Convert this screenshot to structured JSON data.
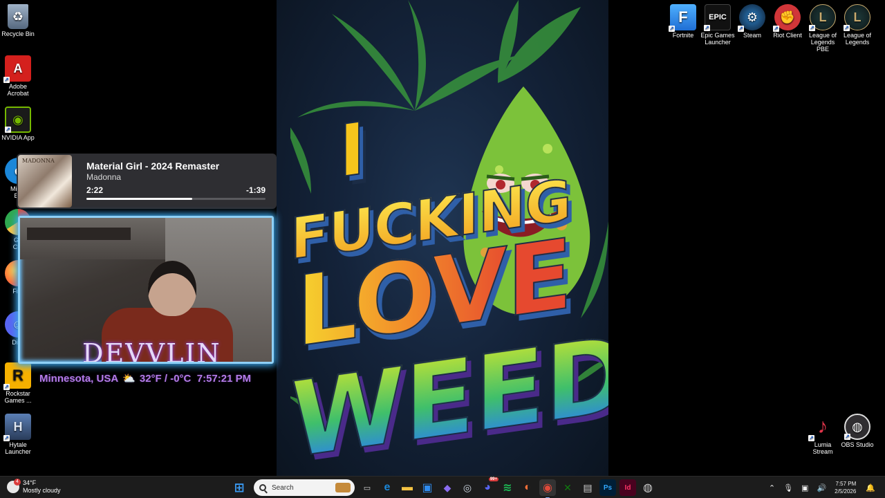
{
  "desktop": {
    "left_icons": [
      {
        "label": "Recycle Bin",
        "icon": "recycle-bin-icon",
        "color": "#6b7f95"
      },
      {
        "label": "Adobe Acrobat",
        "icon": "adobe-acrobat-icon",
        "color": "#d4201d"
      },
      {
        "label": "NVIDIA App",
        "icon": "nvidia-icon",
        "color": "#76b900"
      },
      {
        "label": "Microsoft Edge",
        "icon": "edge-icon",
        "color": "#1b87d9"
      },
      {
        "label": "Google Chrome",
        "icon": "chrome-icon",
        "color": "#e04a3a"
      },
      {
        "label": "Firefox",
        "icon": "firefox-icon",
        "color": "#ff7139"
      },
      {
        "label": "Discord",
        "icon": "discord-icon",
        "color": "#5865f2"
      },
      {
        "label": "Rockstar Games ...",
        "icon": "rockstar-icon",
        "color": "#f6b100"
      },
      {
        "label": "Hytale Launcher",
        "icon": "hytale-icon",
        "color": "#2a3c5a"
      }
    ],
    "left_icons_visible": [
      "Recycle Bin",
      "Adobe\nAcrobat",
      "NVIDIA App",
      "Micro\nEd",
      "Go\nChr",
      "Fire",
      "Disc",
      "Rockstar\nGames ...",
      "Hytale\nLauncher"
    ],
    "right_icons": [
      {
        "label": "Fortnite",
        "icon": "fortnite-icon",
        "color": "#2f80ed"
      },
      {
        "label": "Epic Games Launcher",
        "icon": "epic-games-icon",
        "color": "#111111"
      },
      {
        "label": "Steam",
        "icon": "steam-icon",
        "color": "#1b2838"
      },
      {
        "label": "Riot Client",
        "icon": "riot-client-icon",
        "color": "#d13639"
      },
      {
        "label": "League of Legends PBE",
        "icon": "league-pbe-icon",
        "color": "#c8aa6e"
      },
      {
        "label": "League of Legends",
        "icon": "league-icon",
        "color": "#c8aa6e"
      }
    ],
    "bottom_right_icons": [
      {
        "label": "Lumia Stream",
        "icon": "lumia-stream-icon",
        "color": "#e0344a"
      },
      {
        "label": "OBS Studio",
        "icon": "obs-icon",
        "color": "#302e31"
      }
    ]
  },
  "wallpaper": {
    "line1": "I",
    "line2": "FUCKING",
    "line3": "LOVE",
    "line4": "WEED"
  },
  "now_playing": {
    "title": "Material Girl - 2024 Remaster",
    "artist": "Madonna",
    "elapsed": "2:22",
    "remaining": "-1:39",
    "progress_fraction": 0.59,
    "album_text": "MADONNA"
  },
  "stream_overlay": {
    "logo": "DEVVLIN",
    "location": "Minnesota, USA",
    "temperature": "32°F / -0°C",
    "time": "7:57:21 PM"
  },
  "taskbar": {
    "weather_temp": "34°F",
    "weather_desc": "Mostly cloudy",
    "weather_badge": "4",
    "search_placeholder": "Search",
    "apps": [
      {
        "name": "start-button",
        "glyph": "⊞",
        "color": "#3a9bf4"
      },
      {
        "name": "task-view",
        "glyph": "▭",
        "color": "#cfcfcf"
      },
      {
        "name": "edge",
        "glyph": "e",
        "color": "#1b87d9"
      },
      {
        "name": "file-explorer",
        "glyph": "▬",
        "color": "#f6c343"
      },
      {
        "name": "microsoft-store",
        "glyph": "▣",
        "color": "#2f8cf0"
      },
      {
        "name": "copilot",
        "glyph": "◆",
        "color": "#8a6cf0"
      },
      {
        "name": "steam",
        "glyph": "◎",
        "color": "#cfd8e3"
      },
      {
        "name": "discord",
        "glyph": "◕",
        "color": "#5865f2"
      },
      {
        "name": "spotify",
        "glyph": "≋",
        "color": "#1db954"
      },
      {
        "name": "firefox",
        "glyph": "◐",
        "color": "#ff7139"
      },
      {
        "name": "chrome",
        "glyph": "◉",
        "color": "#e04a3a"
      },
      {
        "name": "xbox",
        "glyph": "✕",
        "color": "#107c10"
      },
      {
        "name": "notepad",
        "glyph": "▤",
        "color": "#cfcfcf"
      },
      {
        "name": "photoshop",
        "glyph": "Ps",
        "color": "#31a8ff"
      },
      {
        "name": "indesign",
        "glyph": "Id",
        "color": "#ff3366"
      },
      {
        "name": "obs",
        "glyph": "◍",
        "color": "#cfcfcf"
      }
    ],
    "discord_badge": "99+",
    "clock_time": "7:57 PM",
    "clock_date": "2/5/2026"
  }
}
